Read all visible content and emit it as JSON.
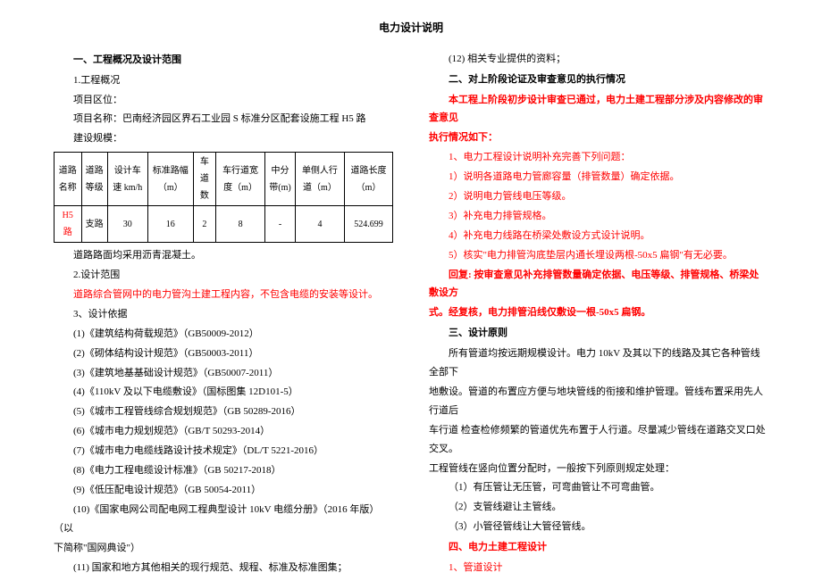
{
  "title": "电力设计说明",
  "left": {
    "s1_header": "一、工程概况及设计范围",
    "s1_1": "1.工程概况",
    "s1_area": "项目区位：",
    "s1_name": "项目名称：巴南经济园区界石工业园 S 标准分区配套设施工程 H5 路",
    "s1_scale": "建设规模：",
    "table": {
      "headers": [
        "道路名称",
        "道路等级",
        "设计车速 km/h",
        "标准路幅（m）",
        "车道数",
        "车行道宽度（m）",
        "中分带(m)",
        "单侧人行道（m）",
        "道路长度（m）"
      ],
      "row": [
        "H5 路",
        "支路",
        "30",
        "16",
        "2",
        "8",
        "-",
        "4",
        "524.699"
      ]
    },
    "s1_pavement": "道路路面均采用沥青混凝土。",
    "s1_2": "2.设计范围",
    "s1_2_body": "道路综合管网中的电力管沟土建工程内容，不包含电缆的安装等设计。",
    "s1_3": "3、设计依据",
    "refs": [
      "(1)《建筑结构荷载规范》（GB50009-2012）",
      "(2)《砌体结构设计规范》（GB50003-2011）",
      "(3)《建筑地基基础设计规范》（GB50007-2011）",
      "(4)《110kV 及以下电缆敷设》（国标图集 12D101-5）",
      "(5)《城市工程管线综合规划规范》（GB 50289-2016）",
      "(6)《城市电力规划规范》（GB/T 50293-2014）",
      "(7)《城市电力电缆线路设计技术规定》（DL/T 5221-2016）",
      "(8)《电力工程电缆设计标准》（GB 50217-2018）",
      "(9)《低压配电设计规范》（GB 50054-2011）"
    ],
    "ref10a": "(10)《国家电网公司配电网工程典型设计  10kV 电缆分册》（2016 年版）（以",
    "ref10b": "下简称\"国网典设\"）",
    "ref11": "(11) 国家和地方其他相关的现行规范、规程、标准及标准图集；"
  },
  "right": {
    "s12": "(12) 相关专业提供的资料；",
    "s2_header": "二、对上阶段论证及审查意见的执行情况",
    "s2_intro1": "本工程上阶段初步设计审查已通过，电力土建工程部分涉及内容修改的审查意见",
    "s2_intro2": "执行情况如下：",
    "s2_items": [
      "1、电力工程设计说明补充完善下列问题：",
      "1）说明各道路电力管廊容量（排管数量）确定依据。",
      "2）说明电力管线电压等级。",
      "3）补充电力排管规格。",
      "4）补充电力线路在桥梁处敷设方式设计说明。",
      "5）核实\"电力排管沟底垫层内通长埋设两根-50x5 扁钢\"有无必要。"
    ],
    "s2_reply1": "回复: 按审查意见补充排管数量确定依据、电压等级、排管规格、桥梁处敷设方",
    "s2_reply2": "式。经复核，电力排管沿线仅敷设一根-50x5 扁钢。",
    "s3_header": "三、设计原则",
    "s3_p1": "所有管道均按远期规模设计。电力 10kV 及其以下的线路及其它各种管线全部下",
    "s3_p2": "地敷设。管道的布置应方便与地块管线的衔接和维护管理。管线布置采用先人行道后",
    "s3_p3": "车行道 检查检修频繁的管道优先布置于人行道。尽量减少管线在道路交叉口处交叉。",
    "s3_p4": "工程管线在竖向位置分配时，一般按下列原则规定处理：",
    "s3_items": [
      "（1）有压管让无压管，可弯曲管让不可弯曲管。",
      "（2）支管线避让主管线。",
      "（3）小管径管线让大管径管线。"
    ],
    "s4_header": "四、电力土建工程设计",
    "s4_1": "1、管道设计"
  }
}
